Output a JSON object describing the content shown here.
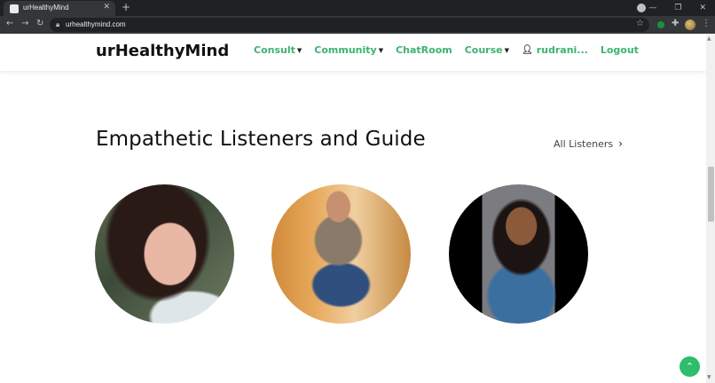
{
  "browser": {
    "tab_title": "urHealthyMind",
    "url": "urhealthymind.com"
  },
  "site": {
    "logo": "urHealthyMind",
    "nav": [
      {
        "label": "Consult",
        "has_caret": true
      },
      {
        "label": "Community",
        "has_caret": true
      },
      {
        "label": "ChatRoom",
        "has_caret": false
      },
      {
        "label": "Course",
        "has_caret": true
      },
      {
        "label": "rudrani...",
        "has_caret": false
      },
      {
        "label": "Logout",
        "has_caret": false
      }
    ],
    "accent_color": "#3cb371"
  },
  "section": {
    "title": "Empathetic Listeners and Guide",
    "all_link": "All Listeners"
  },
  "listeners": [
    {
      "photo": "listener-photo-1"
    },
    {
      "photo": "listener-photo-2"
    },
    {
      "photo": "listener-photo-3"
    }
  ],
  "icons": {
    "scroll_top": "chevron-up-icon",
    "user": "user-icon"
  }
}
